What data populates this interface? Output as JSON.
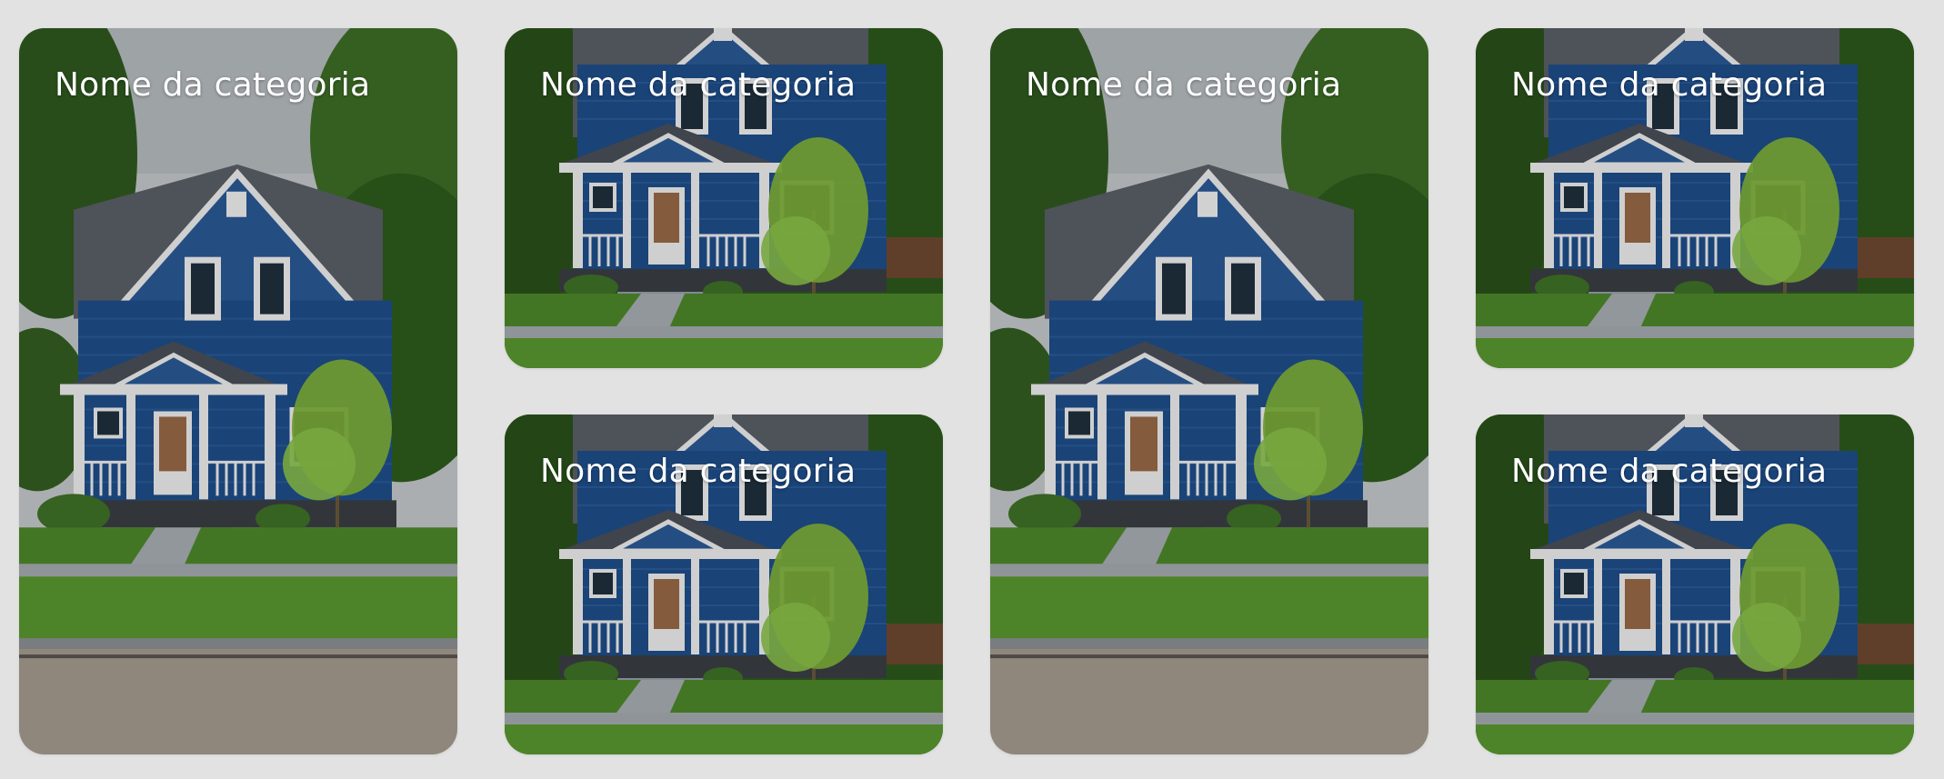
{
  "categories": [
    {
      "name": "Nome da categoria",
      "size": "tall",
      "image": "house-photo"
    },
    {
      "name": "Nome da categoria",
      "size": "short",
      "image": "house-photo"
    },
    {
      "name": "Nome da categoria",
      "size": "short",
      "image": "house-photo"
    },
    {
      "name": "Nome da categoria",
      "size": "tall",
      "image": "house-photo"
    },
    {
      "name": "Nome da categoria",
      "size": "short",
      "image": "house-photo"
    },
    {
      "name": "Nome da categoria",
      "size": "short",
      "image": "house-photo"
    }
  ],
  "colors": {
    "background": "#e2e2e2",
    "house_siding": "#1f4f8c",
    "trim": "#f2f2f2",
    "lawn": "#4e8a2a",
    "sky": "#c9ccce"
  }
}
